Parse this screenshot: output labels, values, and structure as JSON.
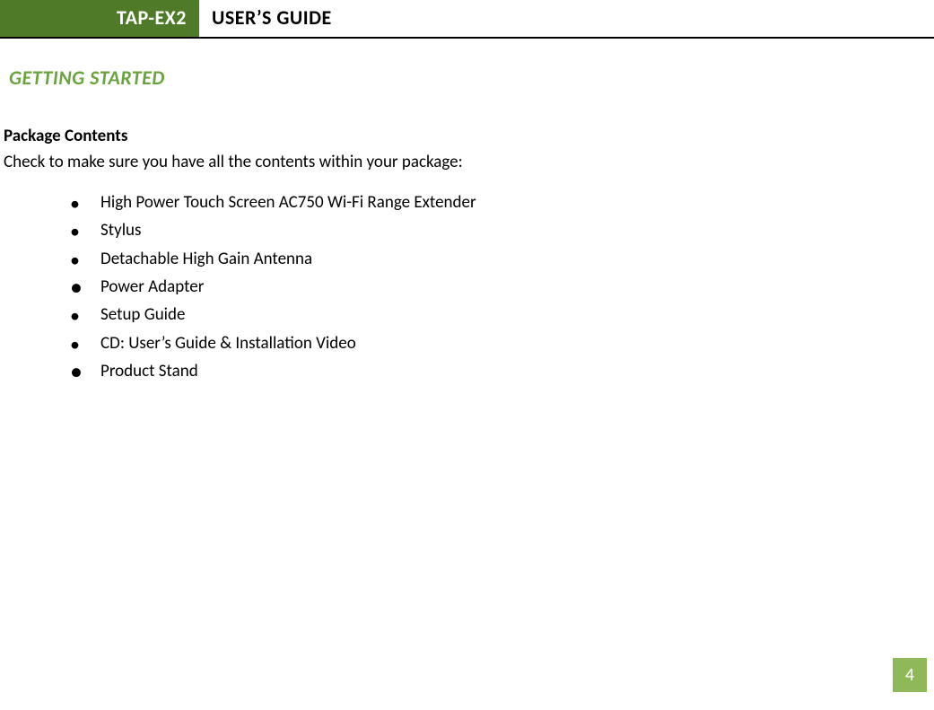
{
  "header": {
    "badge": "TAP-EX2",
    "title": "USER’S GUIDE"
  },
  "section_heading": "GETTING STARTED",
  "subheading": "Package Contents",
  "intro": "Check to make sure you have all the contents within your package:",
  "items": [
    "High Power Touch Screen AC750 Wi-Fi Range Extender",
    "Stylus",
    "Detachable High Gain Antenna",
    "Power Adapter",
    "Setup Guide",
    "CD: User’s Guide & Installation Video",
    "Product Stand"
  ],
  "page_number": "4",
  "colors": {
    "brand_green_dark": "#4f7a28",
    "brand_green_light": "#8fb858",
    "heading_green": "#6aa33e"
  }
}
